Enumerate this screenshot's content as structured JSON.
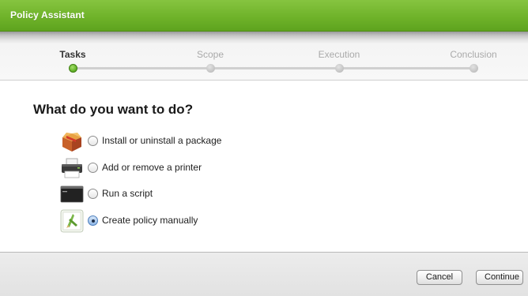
{
  "window": {
    "title": "Policy Assistant",
    "accent_color": "#6fb32a"
  },
  "steps": [
    {
      "label": "Tasks",
      "active": true
    },
    {
      "label": "Scope",
      "active": false
    },
    {
      "label": "Execution",
      "active": false
    },
    {
      "label": "Conclusion",
      "active": false
    }
  ],
  "main": {
    "heading": "What do you want to do?",
    "options": [
      {
        "label": "Install or uninstall a package",
        "icon": "package-box-icon",
        "selected": false
      },
      {
        "label": "Add or remove a printer",
        "icon": "printer-icon",
        "selected": false
      },
      {
        "label": "Run a script",
        "icon": "terminal-script-icon",
        "selected": false
      },
      {
        "label": "Create policy manually",
        "icon": "manual-policy-icon",
        "selected": true
      }
    ]
  },
  "footer": {
    "cancel_label": "Cancel",
    "continue_label": "Continue"
  }
}
